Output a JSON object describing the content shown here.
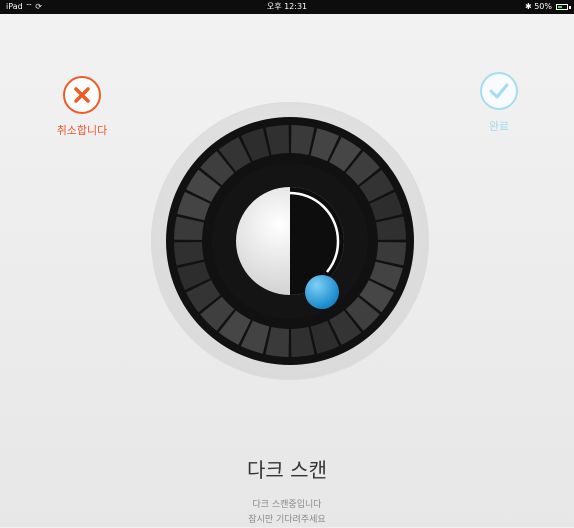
{
  "status_bar": {
    "device": "iPad ⌔ ⟳",
    "time": "오후 12:31",
    "battery": "✱ 50%",
    "battery_level": 0.5,
    "battery_color": "#4cd964"
  },
  "cancel": {
    "label": "취소합니다",
    "icon": "close-icon",
    "color": "#f05a23"
  },
  "done": {
    "label": "완료",
    "icon": "checkmark-icon",
    "color": "#a6dcef"
  },
  "scan": {
    "title": "다크 스캔",
    "line1": "다크 스캔중입니다",
    "line2": "잠시만 기다려주세요",
    "indicator_color": "#29a3e6",
    "segment_count": 28
  }
}
